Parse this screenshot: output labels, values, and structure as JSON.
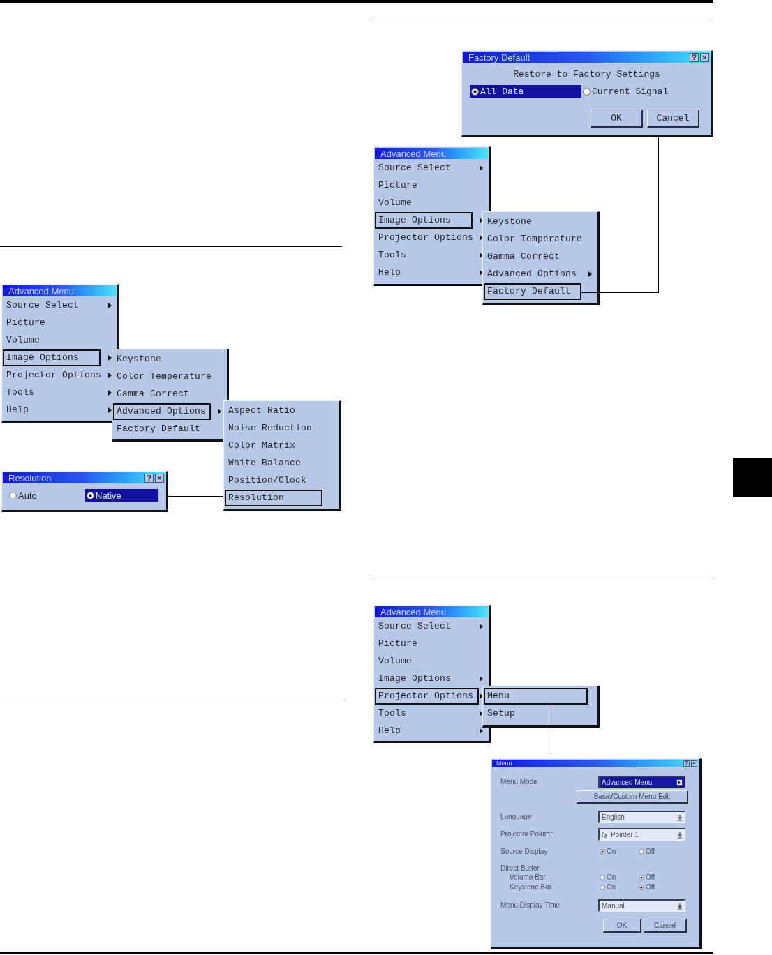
{
  "figures": [
    {
      "menus": [
        {
          "title": "Advanced Menu",
          "items": [
            {
              "label": "Source Select",
              "submenu": true,
              "selected": false
            },
            {
              "label": "Picture",
              "submenu": false,
              "selected": false
            },
            {
              "label": "Volume",
              "submenu": false,
              "selected": false
            },
            {
              "label": "Image Options",
              "submenu": true,
              "selected": true
            },
            {
              "label": "Projector Options",
              "submenu": true,
              "selected": false
            },
            {
              "label": "Tools",
              "submenu": true,
              "selected": false
            },
            {
              "label": "Help",
              "submenu": true,
              "selected": false
            }
          ]
        },
        {
          "items": [
            {
              "label": "Keystone",
              "submenu": false,
              "selected": false
            },
            {
              "label": "Color Temperature",
              "submenu": false,
              "selected": false
            },
            {
              "label": "Gamma Correct",
              "submenu": false,
              "selected": false
            },
            {
              "label": "Advanced Options",
              "submenu": true,
              "selected": true
            },
            {
              "label": "Factory Default",
              "submenu": false,
              "selected": false
            }
          ]
        },
        {
          "items": [
            {
              "label": "Aspect Ratio",
              "submenu": false,
              "selected": false
            },
            {
              "label": "Noise Reduction",
              "submenu": false,
              "selected": false
            },
            {
              "label": "Color Matrix",
              "submenu": false,
              "selected": false
            },
            {
              "label": "White Balance",
              "submenu": false,
              "selected": false
            },
            {
              "label": "Position/Clock",
              "submenu": false,
              "selected": false
            },
            {
              "label": "Resolution",
              "submenu": false,
              "selected": true
            }
          ]
        }
      ],
      "dialog": {
        "kind": "radio_dialog",
        "title": "Resolution",
        "title_buttons": [
          "?",
          "×"
        ],
        "options": [
          {
            "label": "Auto",
            "selected": false
          },
          {
            "label": "Native",
            "selected": true
          }
        ]
      }
    },
    {
      "dialog": {
        "kind": "confirm_dialog",
        "title": "Factory Default",
        "title_buttons": [
          "?",
          "×"
        ],
        "message": "Restore to Factory Settings",
        "options": [
          {
            "label": "All Data",
            "selected": true
          },
          {
            "label": "Current Signal",
            "selected": false
          }
        ],
        "buttons": [
          "OK",
          "Cancel"
        ]
      },
      "menus": [
        {
          "title": "Advanced Menu",
          "items": [
            {
              "label": "Source Select",
              "submenu": true,
              "selected": false
            },
            {
              "label": "Picture",
              "submenu": false,
              "selected": false
            },
            {
              "label": "Volume",
              "submenu": false,
              "selected": false
            },
            {
              "label": "Image Options",
              "submenu": true,
              "selected": true
            },
            {
              "label": "Projector Options",
              "submenu": true,
              "selected": false
            },
            {
              "label": "Tools",
              "submenu": true,
              "selected": false
            },
            {
              "label": "Help",
              "submenu": true,
              "selected": false
            }
          ]
        },
        {
          "items": [
            {
              "label": "Keystone",
              "submenu": false,
              "selected": false
            },
            {
              "label": "Color Temperature",
              "submenu": false,
              "selected": false
            },
            {
              "label": "Gamma Correct",
              "submenu": false,
              "selected": false
            },
            {
              "label": "Advanced Options",
              "submenu": true,
              "selected": false
            },
            {
              "label": "Factory Default",
              "submenu": false,
              "selected": true
            }
          ]
        }
      ]
    },
    {
      "menus": [
        {
          "title": "Advanced Menu",
          "items": [
            {
              "label": "Source Select",
              "submenu": true,
              "selected": false
            },
            {
              "label": "Picture",
              "submenu": false,
              "selected": false
            },
            {
              "label": "Volume",
              "submenu": false,
              "selected": false
            },
            {
              "label": "Image Options",
              "submenu": true,
              "selected": false
            },
            {
              "label": "Projector Options",
              "submenu": true,
              "selected": true
            },
            {
              "label": "Tools",
              "submenu": true,
              "selected": false
            },
            {
              "label": "Help",
              "submenu": true,
              "selected": false
            }
          ]
        },
        {
          "items": [
            {
              "label": "Menu",
              "submenu": false,
              "selected": true
            },
            {
              "label": "Setup",
              "submenu": false,
              "selected": false
            }
          ]
        }
      ],
      "dialog": {
        "kind": "settings_dialog",
        "title": "Menu",
        "title_buttons": [
          "?",
          "×"
        ],
        "rows": [
          {
            "kind": "dropdown",
            "label": "Menu Mode",
            "value": "Advanced Menu",
            "focused": true
          },
          {
            "kind": "button",
            "label": "Basic/Custom Menu Edit"
          },
          {
            "kind": "dropdown",
            "label": "Language",
            "value": "English",
            "focused": false
          },
          {
            "kind": "pointer_dropdown",
            "label": "Projector Pointer",
            "value": "Pointer 1",
            "focused": false
          },
          {
            "kind": "radio",
            "label": "Source Display",
            "options": [
              {
                "label": "On",
                "selected": true
              },
              {
                "label": "Off",
                "selected": false
              }
            ]
          },
          {
            "kind": "group",
            "label": "Direct Button",
            "children": [
              {
                "kind": "radio",
                "label": "Volume Bar",
                "options": [
                  {
                    "label": "On",
                    "selected": false
                  },
                  {
                    "label": "Off",
                    "selected": true
                  }
                ]
              },
              {
                "kind": "radio",
                "label": "Keystone Bar",
                "options": [
                  {
                    "label": "On",
                    "selected": false
                  },
                  {
                    "label": "Off",
                    "selected": true
                  }
                ]
              }
            ]
          },
          {
            "kind": "dropdown",
            "label": "Menu Display Time",
            "value": "Manual",
            "focused": false
          }
        ],
        "buttons": [
          "OK",
          "Cancel"
        ]
      }
    }
  ]
}
